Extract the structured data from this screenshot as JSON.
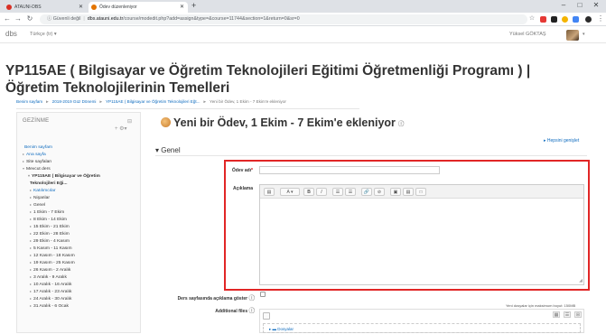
{
  "browser": {
    "tabs": [
      {
        "label": "ATAUNI-DBS",
        "active": false,
        "icon_color": "#d93025"
      },
      {
        "label": "Ödev düzenleniyor",
        "active": true,
        "icon_color": "#e37400"
      }
    ],
    "url_secure": "Güvenli değil",
    "url_domain": "dbs.atauni.edu.tr",
    "url_path": "/course/modedit.php?add=assign&type=&course=11744&section=1&return=0&sr=0",
    "new_tab": "+",
    "win_min": "–",
    "win_max": "□",
    "win_close": "✕"
  },
  "header": {
    "brand": "dbs",
    "language": "Türkçe (tr) ▾",
    "user": "Yüksel GÖKTAŞ",
    "caret": "▾"
  },
  "course_title": "YP115AE ( Bilgisayar ve Öğretim Teknolojileri Eğitimi Öğretmenliği Programı ) | Öğretim Teknolojilerinin Temelleri",
  "breadcrumb": [
    "Benim sayfam",
    "2018-2019 Güz Dönemi",
    "YP115AE ( Bilgisayar ve Öğretim Teknolojileri Eğt...",
    "Yeni bir Ödev, 1 Ekim - 7 Ekim'e ekleniyor"
  ],
  "sidebar": {
    "title": "GEZİNME",
    "items": [
      {
        "label": "Benim sayfam",
        "style": "link"
      },
      {
        "label": "Ana sayfa",
        "style": "link"
      },
      {
        "label": "Site sayfaları",
        "style": "plain"
      },
      {
        "label": "Mevcut ders",
        "style": "plain"
      },
      {
        "label": "YP115AE ( Bilgisayar ve Öğretim",
        "style": "bold"
      },
      {
        "label": "Teknolojileri Eği...",
        "style": "bold"
      },
      {
        "label": "Katılımcılar",
        "style": "link"
      },
      {
        "label": "Nişanlar",
        "style": "plain"
      },
      {
        "label": "Genel",
        "style": "plain"
      },
      {
        "label": "1 Ekim - 7 Ekim",
        "style": "plain"
      },
      {
        "label": "8 Ekim - 14 Ekim",
        "style": "plain"
      },
      {
        "label": "15 Ekim - 21 Ekim",
        "style": "plain"
      },
      {
        "label": "22 Ekim - 28 Ekim",
        "style": "plain"
      },
      {
        "label": "29 Ekim - 4 Kasım",
        "style": "plain"
      },
      {
        "label": "5 Kasım - 11 Kasım",
        "style": "plain"
      },
      {
        "label": "12 Kasım - 18 Kasım",
        "style": "plain"
      },
      {
        "label": "19 Kasım - 25 Kasım",
        "style": "plain"
      },
      {
        "label": "26 Kasım - 2 Aralık",
        "style": "plain"
      },
      {
        "label": "3 Aralık - 9 Aralık",
        "style": "plain"
      },
      {
        "label": "10 Aralık - 16 Aralık",
        "style": "plain"
      },
      {
        "label": "17 Aralık - 23 Aralık",
        "style": "plain"
      },
      {
        "label": "24 Aralık - 30 Aralık",
        "style": "plain"
      },
      {
        "label": "31 Aralık - 6 Ocak",
        "style": "plain"
      }
    ]
  },
  "main": {
    "heading": "Yeni bir Ödev, 1 Ekim - 7 Ekim'e ekleniyor",
    "expand_all": "Hepsini genişlet",
    "section": "Genel",
    "assignment_name_label": "Ödev adı",
    "required_mark": "*",
    "description_label": "Açıklama",
    "editor_buttons": [
      "▤",
      "A ▾",
      "B",
      "I",
      "☰",
      "☰",
      "🔗",
      "⊘",
      "▣",
      "▤",
      "□"
    ],
    "show_description_label": "Ders sayfasında açıklama göster",
    "additional_files_label": "Additional files",
    "max_size_note": "Yeni dosyalar için maksimum boyut: 150MB",
    "files_folder": "Dosyalar"
  }
}
